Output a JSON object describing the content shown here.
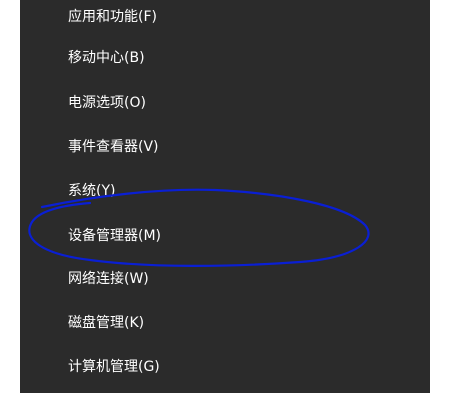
{
  "menu": {
    "items": [
      {
        "label": "应用和功能(F)"
      },
      {
        "label": "移动中心(B)"
      },
      {
        "label": "电源选项(O)"
      },
      {
        "label": "事件查看器(V)"
      },
      {
        "label": "系统(Y)"
      },
      {
        "label": "设备管理器(M)"
      },
      {
        "label": "网络连接(W)"
      },
      {
        "label": "磁盘管理(K)"
      },
      {
        "label": "计算机管理(G)"
      }
    ]
  },
  "annotation": {
    "color": "#0a1fd4"
  }
}
